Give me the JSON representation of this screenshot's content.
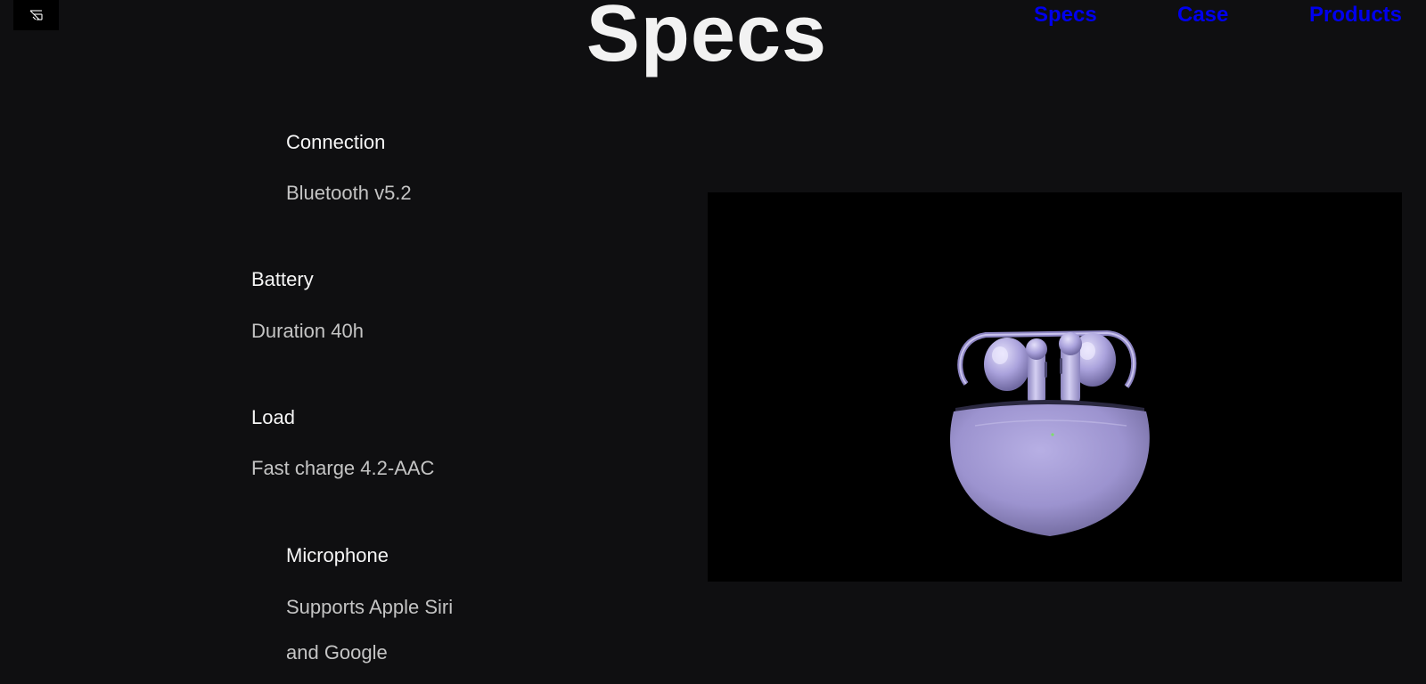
{
  "header": {
    "logo_icon": "brand-logo-icon",
    "title": "Specs"
  },
  "nav": {
    "items": [
      {
        "label": "Specs"
      },
      {
        "label": "Case"
      },
      {
        "label": "Products"
      }
    ],
    "link_color": "#0000ee"
  },
  "specs": [
    {
      "heading": "Connection",
      "value": "Bluetooth v5.2"
    },
    {
      "heading": "Battery",
      "value": "Duration 40h"
    },
    {
      "heading": "Load",
      "value": "Fast charge 4.2-AAC"
    },
    {
      "heading": "Microphone",
      "value_lines": [
        "Supports Apple Siri",
        "and Google"
      ]
    }
  ],
  "product_image": {
    "subject": "earbuds-charging-case",
    "color": "#a79fd8"
  },
  "colors": {
    "background": "#0f0f11",
    "title": "#f2f2f2",
    "heading": "#f6f6f6",
    "value": "#c4c4c4"
  }
}
